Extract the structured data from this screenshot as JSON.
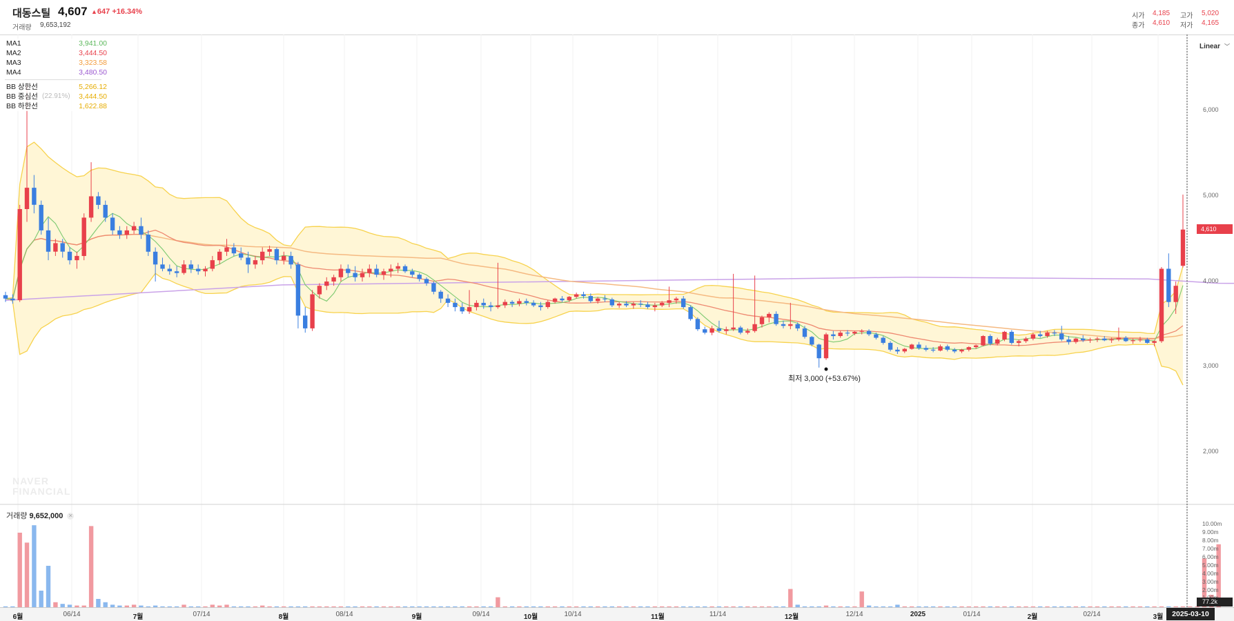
{
  "stock": {
    "name": "대동스틸",
    "price": "4,607",
    "change": "647",
    "change_pct": "+16.34%",
    "volume_label": "거래량",
    "volume": "9,653,192",
    "ohlc": {
      "open_label": "시가",
      "open": "4,185",
      "high_label": "고가",
      "high": "5,020",
      "close_label": "종가",
      "close": "4,610",
      "low_label": "저가",
      "low": "4,165"
    }
  },
  "legend": {
    "ma1": {
      "label": "MA1",
      "value": "3,941.00",
      "color": "#5cb85c"
    },
    "ma2": {
      "label": "MA2",
      "value": "3,444.50",
      "color": "#e8404b"
    },
    "ma3": {
      "label": "MA3",
      "value": "3,323.58",
      "color": "#f39c3c"
    },
    "ma4": {
      "label": "MA4",
      "value": "3,480.50",
      "color": "#9b59d0"
    },
    "bb_upper": {
      "label": "BB 상한선",
      "value": "5,266.12",
      "color": "#f0b400"
    },
    "bb_mid": {
      "label": "BB 중심선",
      "value": "3,444.50",
      "pct": "(22.91%)",
      "color": "#f0b400"
    },
    "bb_lower": {
      "label": "BB 하한선",
      "value": "1,622.88",
      "color": "#f0b400"
    }
  },
  "controls": {
    "scale": "Linear"
  },
  "watermark": {
    "line1": "NAVER",
    "line2": "FINANCIAL"
  },
  "annotation": {
    "low": "최저 3,000 (+53.67%)"
  },
  "volume_pane": {
    "label": "거래량",
    "value": "9,652,000",
    "last_tag": "77.2k"
  },
  "y_axis": [
    "6,000",
    "5,000",
    "4,000",
    "3,000",
    "2,000"
  ],
  "price_tag": "4,610",
  "volume_axis": [
    "10.00m",
    "9.00m",
    "8.00m",
    "7.00m",
    "6.00m",
    "5.00m",
    "4.00m",
    "3.00m",
    "2.00m",
    "1.00m"
  ],
  "x_axis": [
    {
      "label": "6월",
      "major": true
    },
    {
      "label": "06/14",
      "major": false
    },
    {
      "label": "7월",
      "major": true
    },
    {
      "label": "07/14",
      "major": false
    },
    {
      "label": "8월",
      "major": true
    },
    {
      "label": "08/14",
      "major": false
    },
    {
      "label": "9월",
      "major": true
    },
    {
      "label": "09/14",
      "major": false
    },
    {
      "label": "10월",
      "major": true
    },
    {
      "label": "10/14",
      "major": false
    },
    {
      "label": "11월",
      "major": true
    },
    {
      "label": "11/14",
      "major": false
    },
    {
      "label": "12월",
      "major": true
    },
    {
      "label": "12/14",
      "major": false
    },
    {
      "label": "2025",
      "major": true
    },
    {
      "label": "01/14",
      "major": false
    },
    {
      "label": "2월",
      "major": true
    },
    {
      "label": "02/14",
      "major": false
    },
    {
      "label": "3월",
      "major": true
    }
  ],
  "crosshair_date": "2025-03-10",
  "colors": {
    "up": "#e8404b",
    "down": "#3a7ee0",
    "band_fill": "#fff6d6",
    "band_line": "#f7d24c"
  },
  "chart_data": {
    "type": "candlestick",
    "ylim": [
      1500,
      6600
    ],
    "candles": [
      [
        3840,
        3880,
        3760,
        3800
      ],
      [
        3800,
        3850,
        3740,
        3780
      ],
      [
        3780,
        4900,
        3760,
        4850
      ],
      [
        4850,
        6300,
        4700,
        5100
      ],
      [
        5100,
        5250,
        4800,
        4900
      ],
      [
        4900,
        4950,
        4550,
        4600
      ],
      [
        4600,
        4750,
        4250,
        4350
      ],
      [
        4350,
        4500,
        4300,
        4450
      ],
      [
        4450,
        4500,
        4280,
        4350
      ],
      [
        4350,
        4400,
        4200,
        4250
      ],
      [
        4250,
        4350,
        4150,
        4300
      ],
      [
        4300,
        4800,
        4250,
        4750
      ],
      [
        4750,
        5400,
        4700,
        5000
      ],
      [
        5000,
        5050,
        4850,
        4900
      ],
      [
        4900,
        4950,
        4700,
        4750
      ],
      [
        4750,
        4800,
        4550,
        4600
      ],
      [
        4600,
        4650,
        4500,
        4550
      ],
      [
        4550,
        4650,
        4500,
        4600
      ],
      [
        4600,
        4700,
        4560,
        4650
      ],
      [
        4650,
        4750,
        4500,
        4550
      ],
      [
        4550,
        4600,
        4300,
        4350
      ],
      [
        4350,
        4400,
        4000,
        4200
      ],
      [
        4200,
        4280,
        4120,
        4150
      ],
      [
        4150,
        4200,
        4080,
        4120
      ],
      [
        4120,
        4180,
        4050,
        4100
      ],
      [
        4100,
        4250,
        4080,
        4200
      ],
      [
        4200,
        4250,
        4100,
        4150
      ],
      [
        4150,
        4200,
        4080,
        4120
      ],
      [
        4120,
        4180,
        4060,
        4150
      ],
      [
        4150,
        4300,
        4120,
        4250
      ],
      [
        4250,
        4380,
        4200,
        4350
      ],
      [
        4350,
        4500,
        4300,
        4400
      ],
      [
        4400,
        4450,
        4300,
        4330
      ],
      [
        4330,
        4400,
        4250,
        4280
      ],
      [
        4280,
        4350,
        4100,
        4200
      ],
      [
        4200,
        4300,
        4150,
        4250
      ],
      [
        4250,
        4400,
        4200,
        4350
      ],
      [
        4350,
        4420,
        4300,
        4380
      ],
      [
        4380,
        4400,
        4200,
        4250
      ],
      [
        4250,
        4350,
        4200,
        4300
      ],
      [
        4300,
        4350,
        4150,
        4200
      ],
      [
        4200,
        4230,
        3450,
        3600
      ],
      [
        3600,
        3700,
        3400,
        3450
      ],
      [
        3450,
        3900,
        3420,
        3850
      ],
      [
        3850,
        3980,
        3800,
        3950
      ],
      [
        3950,
        4050,
        3900,
        4000
      ],
      [
        4000,
        4080,
        3950,
        4050
      ],
      [
        4050,
        4200,
        4000,
        4150
      ],
      [
        4150,
        4200,
        4050,
        4100
      ],
      [
        4100,
        4180,
        4000,
        4050
      ],
      [
        4050,
        4150,
        4000,
        4100
      ],
      [
        4100,
        4200,
        4050,
        4150
      ],
      [
        4150,
        4200,
        4050,
        4080
      ],
      [
        4080,
        4150,
        4020,
        4120
      ],
      [
        4120,
        4200,
        4050,
        4150
      ],
      [
        4150,
        4220,
        4100,
        4180
      ],
      [
        4180,
        4200,
        4100,
        4120
      ],
      [
        4120,
        4150,
        4050,
        4080
      ],
      [
        4080,
        4100,
        4000,
        4030
      ],
      [
        4030,
        4050,
        3950,
        3980
      ],
      [
        3980,
        4000,
        3850,
        3880
      ],
      [
        3880,
        3900,
        3750,
        3800
      ],
      [
        3800,
        3850,
        3700,
        3750
      ],
      [
        3750,
        3800,
        3650,
        3700
      ],
      [
        3700,
        3750,
        3620,
        3650
      ],
      [
        3650,
        3900,
        3620,
        3700
      ],
      [
        3700,
        3780,
        3660,
        3750
      ],
      [
        3750,
        3800,
        3680,
        3720
      ],
      [
        3720,
        3760,
        3650,
        3700
      ],
      [
        3700,
        4220,
        3680,
        3720
      ],
      [
        3720,
        3790,
        3690,
        3760
      ],
      [
        3760,
        3780,
        3700,
        3740
      ],
      [
        3740,
        3800,
        3710,
        3770
      ],
      [
        3770,
        3800,
        3720,
        3750
      ],
      [
        3750,
        3780,
        3700,
        3720
      ],
      [
        3720,
        3760,
        3660,
        3700
      ],
      [
        3700,
        3780,
        3680,
        3760
      ],
      [
        3760,
        3810,
        3740,
        3800
      ],
      [
        3800,
        3830,
        3760,
        3780
      ],
      [
        3780,
        3830,
        3760,
        3820
      ],
      [
        3820,
        3870,
        3800,
        3850
      ],
      [
        3850,
        3880,
        3800,
        3830
      ],
      [
        3830,
        3860,
        3750,
        3770
      ],
      [
        3770,
        3820,
        3740,
        3800
      ],
      [
        3800,
        3840,
        3760,
        3790
      ],
      [
        3790,
        3810,
        3700,
        3720
      ],
      [
        3720,
        3760,
        3690,
        3740
      ],
      [
        3740,
        3770,
        3700,
        3720
      ],
      [
        3720,
        3760,
        3680,
        3740
      ],
      [
        3740,
        3780,
        3700,
        3730
      ],
      [
        3730,
        3760,
        3680,
        3700
      ],
      [
        3700,
        3750,
        3650,
        3720
      ],
      [
        3720,
        3770,
        3700,
        3750
      ],
      [
        3750,
        3940,
        3700,
        3780
      ],
      [
        3780,
        3820,
        3740,
        3800
      ],
      [
        3800,
        3830,
        3680,
        3700
      ],
      [
        3700,
        3720,
        3540,
        3560
      ],
      [
        3560,
        3580,
        3420,
        3440
      ],
      [
        3440,
        3470,
        3380,
        3400
      ],
      [
        3400,
        3480,
        3370,
        3450
      ],
      [
        3450,
        3540,
        3400,
        3420
      ],
      [
        3420,
        3470,
        3380,
        3440
      ],
      [
        3440,
        4090,
        3420,
        3460
      ],
      [
        3460,
        3480,
        3380,
        3400
      ],
      [
        3400,
        3450,
        3380,
        3420
      ],
      [
        3420,
        4070,
        3400,
        3500
      ],
      [
        3500,
        3600,
        3460,
        3580
      ],
      [
        3580,
        3640,
        3520,
        3620
      ],
      [
        3620,
        3650,
        3480,
        3500
      ],
      [
        3500,
        3540,
        3450,
        3480
      ],
      [
        3480,
        3750,
        3440,
        3500
      ],
      [
        3500,
        3520,
        3420,
        3450
      ],
      [
        3450,
        3480,
        3330,
        3350
      ],
      [
        3350,
        3360,
        3240,
        3260
      ],
      [
        3260,
        3270,
        2990,
        3100
      ],
      [
        3100,
        3400,
        3080,
        3380
      ],
      [
        3380,
        3420,
        3320,
        3360
      ],
      [
        3360,
        3420,
        3340,
        3400
      ],
      [
        3400,
        3430,
        3360,
        3390
      ],
      [
        3390,
        3420,
        3370,
        3410
      ],
      [
        3410,
        3440,
        3380,
        3420
      ],
      [
        3420,
        3440,
        3360,
        3380
      ],
      [
        3380,
        3400,
        3320,
        3340
      ],
      [
        3340,
        3360,
        3260,
        3280
      ],
      [
        3280,
        3300,
        3180,
        3200
      ],
      [
        3200,
        3230,
        3150,
        3180
      ],
      [
        3180,
        3220,
        3160,
        3210
      ],
      [
        3210,
        3270,
        3200,
        3260
      ],
      [
        3260,
        3290,
        3200,
        3220
      ],
      [
        3220,
        3250,
        3180,
        3200
      ],
      [
        3200,
        3230,
        3170,
        3190
      ],
      [
        3190,
        3260,
        3180,
        3240
      ],
      [
        3240,
        3260,
        3180,
        3200
      ],
      [
        3200,
        3220,
        3160,
        3180
      ],
      [
        3180,
        3210,
        3160,
        3200
      ],
      [
        3200,
        3240,
        3180,
        3230
      ],
      [
        3230,
        3260,
        3210,
        3250
      ],
      [
        3250,
        3370,
        3240,
        3360
      ],
      [
        3360,
        3380,
        3250,
        3270
      ],
      [
        3270,
        3340,
        3250,
        3320
      ],
      [
        3320,
        3420,
        3300,
        3410
      ],
      [
        3410,
        3430,
        3260,
        3280
      ],
      [
        3280,
        3320,
        3240,
        3300
      ],
      [
        3300,
        3350,
        3280,
        3330
      ],
      [
        3330,
        3400,
        3310,
        3380
      ],
      [
        3380,
        3420,
        3340,
        3360
      ],
      [
        3360,
        3420,
        3340,
        3400
      ],
      [
        3400,
        3430,
        3360,
        3390
      ],
      [
        3390,
        3480,
        3300,
        3320
      ],
      [
        3320,
        3360,
        3260,
        3290
      ],
      [
        3290,
        3340,
        3270,
        3330
      ],
      [
        3330,
        3370,
        3290,
        3310
      ],
      [
        3310,
        3340,
        3280,
        3320
      ],
      [
        3320,
        3350,
        3290,
        3330
      ],
      [
        3330,
        3360,
        3300,
        3310
      ],
      [
        3310,
        3340,
        3280,
        3320
      ],
      [
        3320,
        3460,
        3300,
        3340
      ],
      [
        3340,
        3360,
        3290,
        3300
      ],
      [
        3300,
        3330,
        3270,
        3310
      ],
      [
        3310,
        3350,
        3290,
        3320
      ],
      [
        3320,
        3340,
        3270,
        3280
      ],
      [
        3280,
        3310,
        3240,
        3300
      ],
      [
        3300,
        4170,
        3280,
        4150
      ],
      [
        4150,
        4330,
        3700,
        3760
      ],
      [
        3760,
        4000,
        3620,
        3950
      ],
      [
        4185,
        5020,
        4165,
        4610
      ]
    ],
    "volume_millions": [
      0.1,
      0.1,
      9.0,
      7.8,
      9.9,
      2.0,
      5.0,
      0.6,
      0.4,
      0.3,
      0.2,
      0.2,
      9.8,
      1.0,
      0.6,
      0.3,
      0.2,
      0.2,
      0.3,
      0.2,
      0.1,
      0.2,
      0.1,
      0.1,
      0.1,
      0.3,
      0.1,
      0.1,
      0.1,
      0.3,
      0.2,
      0.3,
      0.1,
      0.1,
      0.1,
      0.1,
      0.2,
      0.1,
      0.1,
      0.1,
      0.1,
      0.1,
      0.1,
      0.1,
      0.1,
      0.1,
      0.1,
      0.1,
      0.1,
      0.1,
      0.1,
      0.1,
      0.1,
      0.1,
      0.1,
      0.1,
      0.1,
      0.1,
      0.1,
      0.1,
      0.1,
      0.1,
      0.1,
      0.1,
      0.1,
      0.1,
      0.1,
      0.1,
      0.1,
      1.2,
      0.1,
      0.1,
      0.1,
      0.1,
      0.1,
      0.1,
      0.1,
      0.1,
      0.1,
      0.1,
      0.1,
      0.1,
      0.1,
      0.1,
      0.1,
      0.1,
      0.1,
      0.1,
      0.1,
      0.1,
      0.1,
      0.1,
      0.1,
      0.1,
      0.1,
      0.1,
      0.1,
      0.1,
      0.1,
      0.1,
      0.1,
      0.1,
      0.1,
      0.1,
      0.1,
      0.1,
      0.1,
      0.1,
      0.1,
      0.1,
      2.2,
      0.3,
      0.1,
      0.1,
      0.1,
      0.2,
      0.1,
      0.1,
      0.1,
      0.1,
      1.9,
      0.2,
      0.1,
      0.1,
      0.1,
      0.3,
      0.1,
      0.1,
      0.1,
      0.1,
      0.1,
      0.1,
      0.1,
      0.1,
      0.1,
      0.1,
      0.1,
      0.1,
      0.1,
      0.1,
      0.1,
      0.1,
      0.1,
      0.1,
      0.1,
      0.1,
      0.1,
      0.1,
      0.1,
      0.1,
      0.1,
      0.1,
      0.1,
      0.1,
      0.1,
      0.1,
      0.1,
      0.1,
      0.1,
      0.1,
      0.1,
      0.1,
      0.1,
      0.1,
      0.1,
      0.1,
      0.1,
      0.1,
      5.9,
      1.5,
      7.6
    ],
    "ma4_points": [
      [
        0,
        3780
      ],
      [
        40,
        3960
      ],
      [
        130,
        4050
      ],
      [
        165,
        4030
      ],
      [
        175,
        3980
      ],
      [
        1500,
        3470
      ],
      [
        1530,
        3490
      ]
    ]
  }
}
